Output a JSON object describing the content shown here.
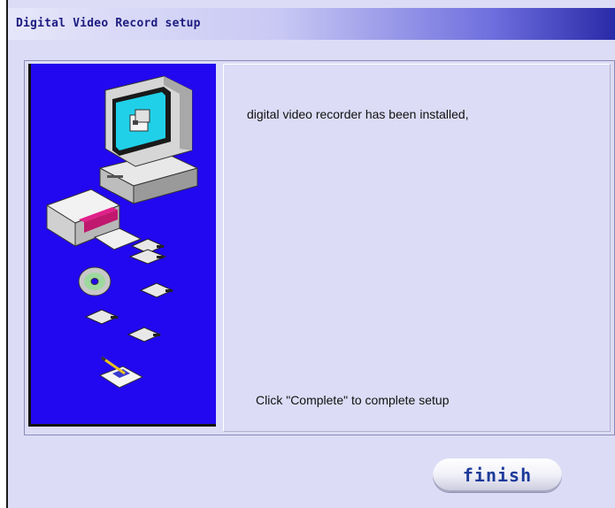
{
  "window": {
    "title": "Digital Video Record setup"
  },
  "main": {
    "installed_message": "digital video recorder has been installed,",
    "complete_hint": "Click \"Complete\" to complete setup"
  },
  "buttons": {
    "finish_label": "finish"
  },
  "illustration": {
    "icons": [
      "computer-icon",
      "cd-drive-icon",
      "floppy-disk-icon",
      "compact-disc-icon",
      "document-pen-icon"
    ]
  },
  "colors": {
    "side_panel": "#2208f0",
    "dialog_background": "#dcdcf6",
    "title_text": "#1c1c80",
    "button_text": "#1c3a9a"
  }
}
